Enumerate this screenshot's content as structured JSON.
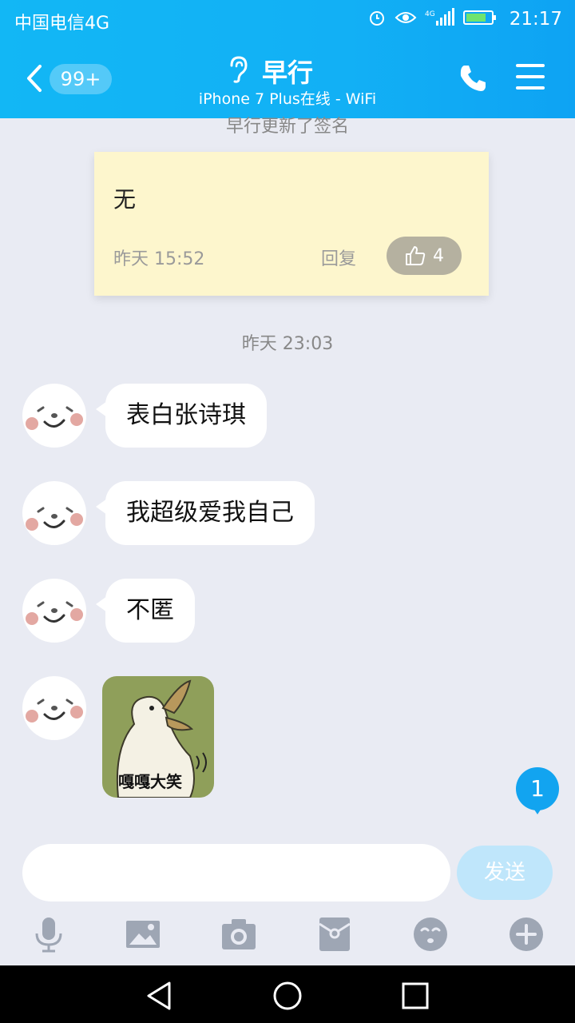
{
  "status_bar": {
    "carrier": "中国电信4G",
    "icons": [
      "alarm-icon",
      "eye-icon",
      "signal-4g-icon",
      "battery-icon"
    ],
    "time": "21:17"
  },
  "header": {
    "badge": "99+",
    "name": "早行",
    "subtitle": "iPhone 7 Plus在线 - WiFi"
  },
  "sign_update": {
    "text": "早行更新了签名",
    "content": "无",
    "time": "昨天 15:52",
    "reply": "回复",
    "likes": "4"
  },
  "chat_time": "昨天 23:03",
  "messages": [
    {
      "text": "表白张诗琪"
    },
    {
      "text": "我超级爱我自己"
    },
    {
      "text": "不匿"
    }
  ],
  "sticker": {
    "caption": "嘎嘎大笑"
  },
  "unread_count": "1",
  "composer": {
    "value": "",
    "send": "发送"
  },
  "toolbar": [
    "mic-icon",
    "image-icon",
    "camera-icon",
    "red-packet-icon",
    "emoji-icon",
    "plus-icon"
  ],
  "colors": {
    "accent": "#12b7f5",
    "background": "#e9ebf3",
    "sign_card": "#fdf6cd"
  }
}
